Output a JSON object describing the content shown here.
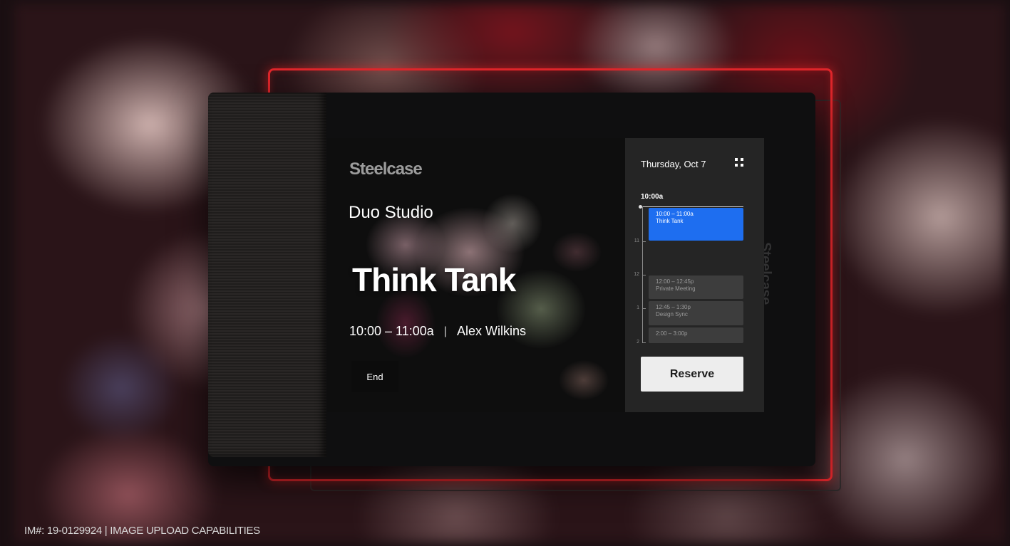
{
  "device": {
    "brand": "Steelcase",
    "side_brand": "Steelcase"
  },
  "hero": {
    "room": "Duo Studio",
    "meeting_title": "Think Tank",
    "time": "10:00 – 11:00a",
    "separator": "|",
    "organizer": "Alex Wilkins",
    "end_label": "End"
  },
  "schedule": {
    "date": "Thursday, Oct 7",
    "now_label": "10:00a",
    "hours": [
      "11",
      "12",
      "1",
      "2"
    ],
    "events": [
      {
        "time": "10:00 – 11:00a",
        "title": "Think Tank",
        "state": "active"
      },
      {
        "time": "12:00 – 12:45p",
        "title": "Private Meeting",
        "state": "upcoming"
      },
      {
        "time": "12:45 – 1:30p",
        "title": "Design Sync",
        "state": "upcoming"
      },
      {
        "time": "2:00 – 3:00p",
        "title": "",
        "state": "upcoming"
      }
    ],
    "reserve_label": "Reserve",
    "grid_icon": "grid-icon"
  },
  "caption": "IM#: 19-0129924 | IMAGE UPLOAD CAPABILITIES",
  "colors": {
    "accent": "#1e6ef0",
    "glow": "#e0262b",
    "panel": "#252525"
  }
}
